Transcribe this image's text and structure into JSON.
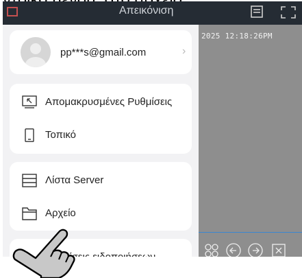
{
  "caption": {
    "text": "ντρικό μενού, στο αρχείο."
  },
  "topbar": {
    "title": "Απεικόνιση"
  },
  "video": {
    "timestamp": "2025 12:18:26PM"
  },
  "account": {
    "email": "pp***s@gmail.com",
    "chevron": "›"
  },
  "menu": {
    "remote_settings": "Απομακρυσμένες Ρυθμίσεις",
    "local": "Τοπικό",
    "server_list": "Λίστα Server",
    "file": "Αρχείο",
    "notification_settings": "Ρυθμίσεις ειδοποιήσεων"
  },
  "icons": {
    "menu": "menu-icon",
    "list": "list-icon",
    "fullscreen": "fullscreen-icon",
    "remote": "remote-settings-icon",
    "local": "phone-icon",
    "server": "server-list-icon",
    "file": "folder-icon",
    "pointer": "hand-pointer-icon"
  },
  "colors": {
    "topbar": "#252c34",
    "drawer": "#f2f2f4",
    "card": "#ffffff",
    "accent_line": "#3a86d0"
  }
}
